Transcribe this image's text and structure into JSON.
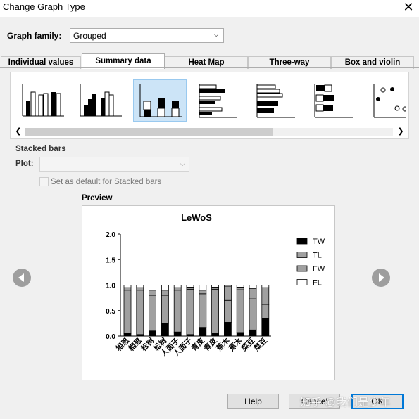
{
  "window": {
    "title": "Change Graph Type",
    "close_glyph": "✕"
  },
  "graph_family": {
    "label": "Graph family:",
    "value": "Grouped"
  },
  "tabs": [
    "Individual values",
    "Summary data",
    "Heat Map",
    "Three-way",
    "Box and violin"
  ],
  "active_tab": "Summary data",
  "gallery": {
    "thumbnails": [
      "grouped-bars",
      "grouped-bars-alt",
      "stacked-bars",
      "horizontal-bars",
      "horizontal-stacked-bars",
      "horizontal-bars-alt",
      "scatter-dots"
    ],
    "selected": "stacked-bars"
  },
  "section": {
    "heading": "Stacked bars",
    "plot_label": "Plot:",
    "plot_value": "",
    "default_label": "Set as default for Stacked bars",
    "default_checked": false
  },
  "preview": {
    "label": "Preview"
  },
  "buttons": {
    "help": "Help",
    "cancel": "Cancel",
    "ok": "OK"
  },
  "watermark": "知乎 @我们是少年",
  "chart_data": {
    "type": "bar",
    "stacked": true,
    "title": "LeWoS",
    "xlabel": "",
    "ylabel": "",
    "ylim": [
      0,
      2.0
    ],
    "yticks": [
      "0.0",
      "0.5",
      "1.0",
      "1.5",
      "2.0"
    ],
    "categories": [
      "相思",
      "相思",
      "松树",
      "松树",
      "人面子",
      "人面子",
      "青皮",
      "青皮",
      "蕉木",
      "蕉木",
      "菜豆",
      "菜豆"
    ],
    "series": [
      {
        "name": "TW",
        "color": "#000000",
        "values": [
          0.05,
          0.03,
          0.1,
          0.25,
          0.08,
          0.03,
          0.17,
          0.06,
          0.27,
          0.07,
          0.12,
          0.35
        ]
      },
      {
        "name": "TL",
        "color": "#a0a0a0",
        "values": [
          0.85,
          0.87,
          0.7,
          0.55,
          0.82,
          0.89,
          0.66,
          0.86,
          0.43,
          0.84,
          0.61,
          0.27
        ]
      },
      {
        "name": "FW",
        "color": "#a0a0a0",
        "values": [
          0.05,
          0.05,
          0.1,
          0.1,
          0.05,
          0.04,
          0.07,
          0.04,
          0.28,
          0.05,
          0.2,
          0.33
        ]
      },
      {
        "name": "FL",
        "color": "#ffffff",
        "values": [
          0.05,
          0.05,
          0.1,
          0.1,
          0.05,
          0.04,
          0.1,
          0.04,
          0.02,
          0.04,
          0.07,
          0.05
        ]
      }
    ],
    "legend_position": "right",
    "grid": false
  }
}
